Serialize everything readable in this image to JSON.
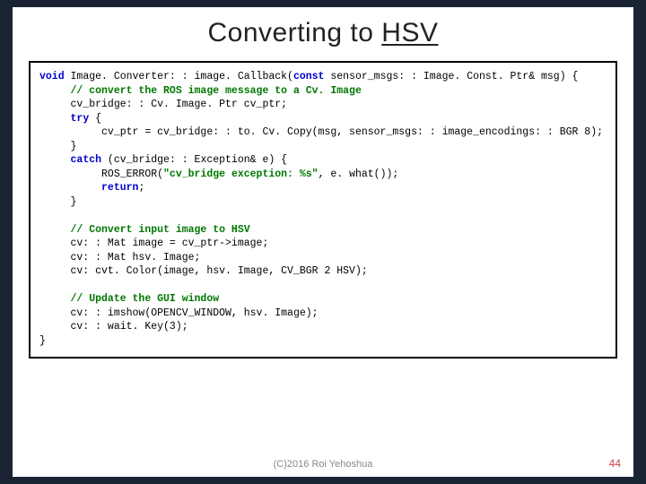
{
  "title_plain": "Converting to ",
  "title_underlined": "HSV",
  "code": {
    "l1a": "void",
    "l1b": " Image. Converter: : image. Callback(",
    "l1c": "const",
    "l1d": " sensor_msgs: : Image. Const. Ptr& msg) {",
    "l2": "     // convert the ROS image message to a Cv. Image",
    "l3": "     cv_bridge: : Cv. Image. Ptr cv_ptr;",
    "l4a": "     ",
    "l4b": "try",
    "l4c": " {",
    "l5": "          cv_ptr = cv_bridge: : to. Cv. Copy(msg, sensor_msgs: : image_encodings: : BGR 8);",
    "l6": "     }",
    "l7a": "     ",
    "l7b": "catch",
    "l7c": " (cv_bridge: : Exception& e) {",
    "l8a": "          ROS_ERROR(",
    "l8b": "\"cv_bridge exception: %s\"",
    "l8c": ", e. what());",
    "l9a": "          ",
    "l9b": "return",
    "l9c": ";",
    "l10": "     }",
    "l12": "     // Convert input image to HSV",
    "l13": "     cv: : Mat image = cv_ptr->image;",
    "l14": "     cv: : Mat hsv. Image;",
    "l15": "     cv: cvt. Color(image, hsv. Image, CV_BGR 2 HSV);",
    "l17": "     // Update the GUI window",
    "l18": "     cv: : imshow(OPENCV_WINDOW, hsv. Image);",
    "l19": "     cv: : wait. Key(3);",
    "l20": "}"
  },
  "footer": {
    "copyright": "(C)2016 Roi Yehoshua",
    "page": "44"
  }
}
